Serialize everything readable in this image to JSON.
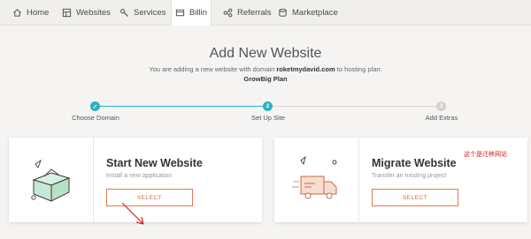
{
  "nav": {
    "items": [
      {
        "label": "Home",
        "icon": "home-icon"
      },
      {
        "label": "Websites",
        "icon": "grid-icon"
      },
      {
        "label": "Services",
        "icon": "services-icon"
      },
      {
        "label": "Billin",
        "icon": "billing-icon"
      },
      {
        "label": "Referrals",
        "icon": "referrals-icon"
      },
      {
        "label": "Marketplace",
        "icon": "marketplace-icon"
      }
    ]
  },
  "header": {
    "title": "Add New Website",
    "subtitle_prefix": "You are adding a new website with domain",
    "domain": "roketmydavid.com",
    "subtitle_suffix": "to hosting plan:",
    "plan": "GrowBig Plan"
  },
  "steps": [
    {
      "number": "✓",
      "label": "Choose Domain",
      "state": "done"
    },
    {
      "number": "2",
      "label": "Set Up Site",
      "state": "active"
    },
    {
      "number": "3",
      "label": "Add Extras",
      "state": "pending"
    }
  ],
  "cards": [
    {
      "title": "Start New Website",
      "description": "Install a new application",
      "button": "SELECT",
      "illustration": "house-box-icon"
    },
    {
      "title": "Migrate Website",
      "description": "Transfer an existing project",
      "button": "SELECT",
      "illustration": "moving-truck-icon"
    }
  ],
  "annotation": "这个是迁移网站",
  "colors": {
    "accent": "#2bb3c0",
    "button": "#e07b55",
    "annotation": "#d62020"
  }
}
